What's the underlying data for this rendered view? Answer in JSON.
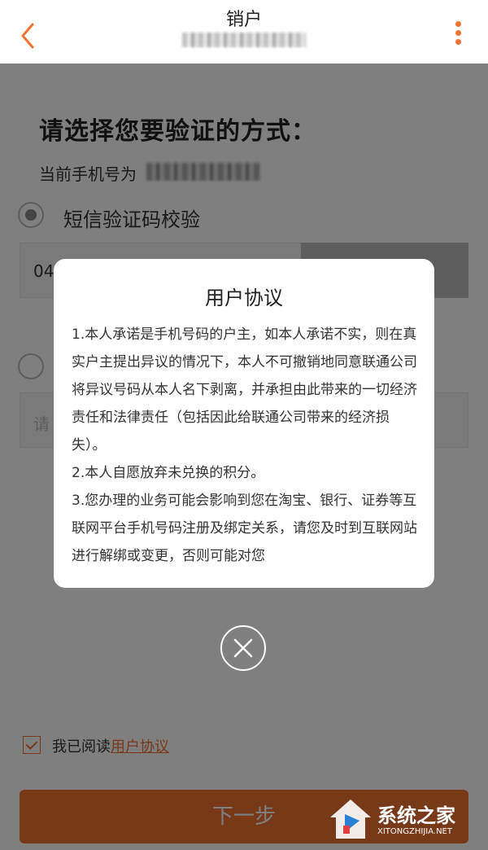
{
  "header": {
    "title": "销户",
    "back_icon": "chevron-left-icon",
    "more_icon": "vertical-dots-icon",
    "accent": "#f07232"
  },
  "main": {
    "prompt": "请选择您要验证的方式：",
    "phone_label": "当前手机号为",
    "option_sms_label": "短信验证码校验",
    "code_value": "04",
    "password_placeholder": "请"
  },
  "agreement": {
    "prefix": "我已阅读",
    "link": "用户协议"
  },
  "next_label": "下一步",
  "modal": {
    "title": "用户协议",
    "paragraphs": [
      "1.本人承诺是手机号码的户主，如本人承诺不实，则在真实户主提出异议的情况下，本人不可撤销地同意联通公司将异议号码从本人名下剥离，并承担由此带来的一切经济责任和法律责任（包括因此给联通公司带来的经济损失）。",
      "2.本人自愿放弃未兑换的积分。",
      "3.您办理的业务可能会影响到您在淘宝、银行、证券等互联网平台手机号码注册及绑定关系，请您及时到互联网站进行解绑或变更，否则可能对您"
    ],
    "close_icon": "close-icon"
  },
  "watermark": {
    "text": "系统之家",
    "sub": "XITONGZHIJIA.NET"
  }
}
